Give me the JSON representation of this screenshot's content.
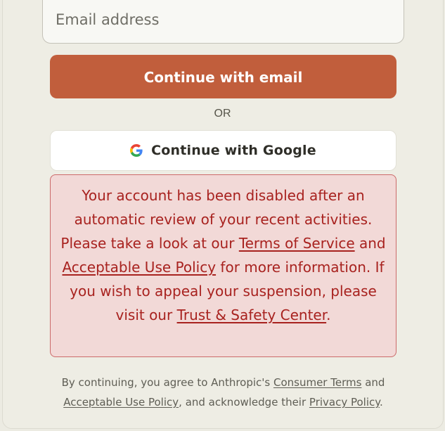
{
  "form": {
    "email_placeholder": "Email address",
    "email_value": "",
    "continue_email_label": "Continue with email",
    "or_label": "OR",
    "continue_google_label": "Continue with Google"
  },
  "alert": {
    "text_1": "Your account has been disabled after an automatic review of your recent activities. Please take a look at our ",
    "link_terms": "Terms of Service",
    "text_2": " and ",
    "link_aup": "Acceptable Use Policy",
    "text_3": " for more information. If you wish to appeal your suspension, please visit our ",
    "link_trust": "Trust & Safety Center",
    "text_4": "."
  },
  "footer": {
    "text_1": "By continuing, you agree to Anthropic's ",
    "link_consumer_terms": "Consumer Terms",
    "text_2": " and ",
    "link_aup": "Acceptable Use Policy",
    "text_3": ", and acknowledge their ",
    "link_privacy": "Privacy Policy",
    "text_4": "."
  },
  "colors": {
    "primary_button": "#c15e3c",
    "alert_background": "#f2d9d7",
    "alert_text": "#a8221f",
    "page_background": "#ecebe2"
  },
  "icons": {
    "google": "google-icon"
  }
}
